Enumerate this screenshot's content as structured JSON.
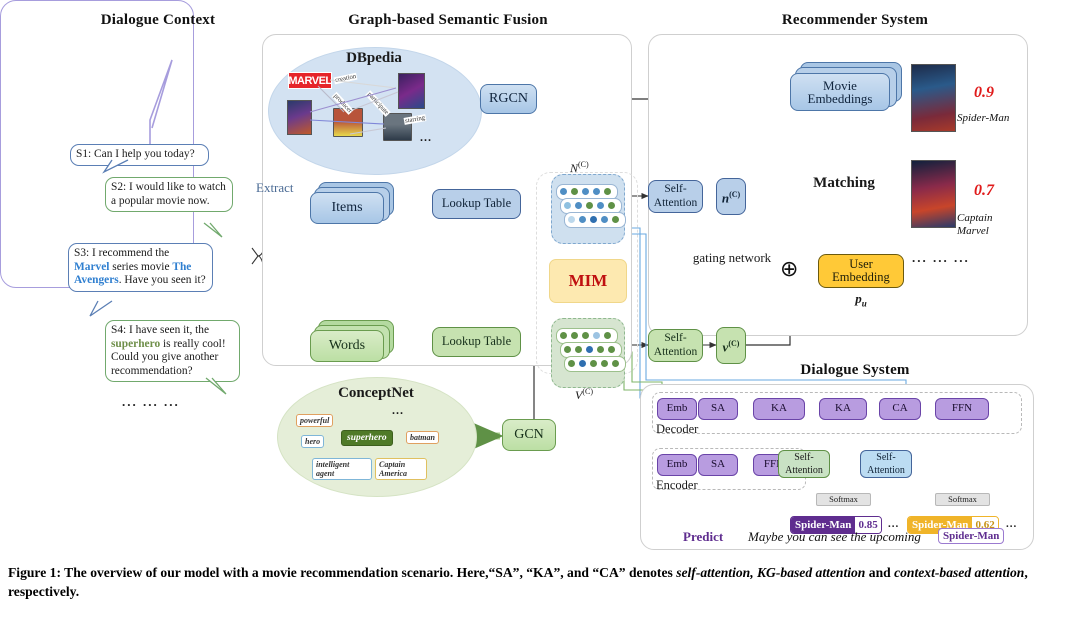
{
  "headers": {
    "dialogue_context": "Dialogue Context",
    "graph_fusion": "Graph-based Semantic Fusion",
    "recommender": "Recommender System",
    "dialogue_system": "Dialogue System"
  },
  "dialogue": {
    "turns": [
      {
        "id": "S1",
        "speaker": "system",
        "text": "S1: Can I help you today?"
      },
      {
        "id": "S2",
        "speaker": "user",
        "text": "S2: I would like to watch a popular movie now."
      },
      {
        "id": "S3",
        "speaker": "system",
        "text": "S3: I recommend the Marvel series movie The Avengers. Have you seen it?"
      },
      {
        "id": "S4",
        "speaker": "user",
        "text": "S4: I have seen it, the superhero is really cool! Could you give another recommendation?"
      }
    ],
    "s3_parts": {
      "pre": "S3: I recommend the ",
      "kw1": "Marvel",
      "mid": " series movie ",
      "kw2": "The Avengers",
      "post": ". Have you seen it?"
    },
    "s4_parts": {
      "pre": "S4: I have seen it, the ",
      "kw": "superhero",
      "post": " is really cool! Could you give another recommendation?"
    },
    "ellipsis": "... ... ..."
  },
  "fusion": {
    "extract_label": "Extract",
    "dbpedia": {
      "title": "DBpedia",
      "marvel_logo": "MARVEL",
      "relations": [
        "creation",
        "producer",
        "participate",
        "starring"
      ],
      "ellipsis": "..."
    },
    "conceptnet": {
      "title": "ConceptNet",
      "ellipsis": "...",
      "nodes": [
        {
          "label": "powerful",
          "style": "orange"
        },
        {
          "label": "hero",
          "style": "blue"
        },
        {
          "label": "superhero",
          "style": "dark-green"
        },
        {
          "label": "batman",
          "style": "orange"
        },
        {
          "label": "intelligent agent",
          "style": "blue"
        },
        {
          "label": "Captain America",
          "style": "orange"
        }
      ]
    },
    "rgcn": "RGCN",
    "gcn": "GCN",
    "items": "Items",
    "words": "Words",
    "lookup_table_items": "Lookup Table",
    "lookup_table_words": "Lookup Table",
    "n_c_label": "N",
    "n_c_sup": "(C)",
    "v_c_label": "V",
    "v_c_sup": "(C)",
    "mim": "MIM",
    "self_attention_top": "Self-Attention",
    "self_attention_bottom": "Self-Attention",
    "n_vec": "n",
    "n_vec_sup": "(C)",
    "v_vec": "v",
    "v_vec_sup": "(C)",
    "gating_network": "gating network",
    "plus_symbol": "⊕"
  },
  "recommender": {
    "movie_embeddings": "Movie Embeddings",
    "matching": "Matching",
    "user_embedding": "User Embedding",
    "p_u": "p",
    "p_u_sub": "u",
    "results": [
      {
        "score": "0.9",
        "title": "Spider-Man"
      },
      {
        "score": "0.7",
        "title": "Captain Marvel"
      }
    ],
    "ellipsis": "... ... ..."
  },
  "dialogue_system": {
    "decoder_label": "Decoder",
    "encoder_label": "Encoder",
    "decoder_blocks": [
      "Emb",
      "SA",
      "KA",
      "KA",
      "CA",
      "FFN"
    ],
    "encoder_blocks": [
      "Emb",
      "SA",
      "FFN"
    ],
    "self_attention_green": "Self-Attention",
    "self_attention_blue": "Self-Attention",
    "softmax_left": "Softmax",
    "softmax_right": "Softmax",
    "outputs": [
      {
        "name": "Spider-Man",
        "value": "0.85",
        "color": "#5f2d8f"
      },
      {
        "name": "Spider-Man",
        "value": "0.62",
        "color": "#f0b429"
      }
    ],
    "output_ellipsis": "...",
    "predict_label": "Predict",
    "predict_sentence": "Maybe you can see the upcoming",
    "predict_token": "Spider-Man"
  },
  "caption": {
    "prefix": "Figure 1: The overview of our model with a movie recommendation scenario. Here,“SA”, “KA”, and “CA” denotes ",
    "italic1": "self-attention, KG-based attention",
    "mid": " and ",
    "italic2": "context-based attention",
    "suffix": ", respectively."
  },
  "colors": {
    "accent_blue": "#4d76a8",
    "accent_green": "#6a9c4f",
    "accent_purple": "#6a44a8",
    "score_red": "#e01b1b",
    "mim_bg": "#fde9b0",
    "user_embedding": "#ffc937"
  }
}
